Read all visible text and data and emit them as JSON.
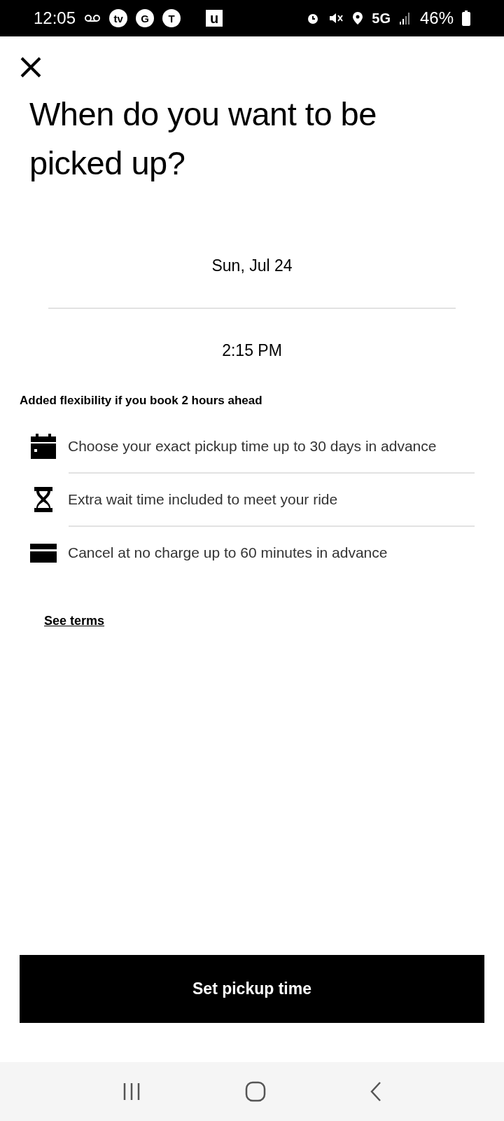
{
  "status_bar": {
    "time": "12:05",
    "badges": [
      "tv",
      "G",
      "T"
    ],
    "square_badge": "u",
    "network": "5G",
    "battery": "46%"
  },
  "title": "When do you want to be picked up?",
  "picker": {
    "date": "Sun, Jul 24",
    "time": "2:15 PM"
  },
  "benefits": {
    "heading": "Added flexibility if you book 2 hours ahead",
    "items": [
      {
        "kind": "calendar",
        "text": "Choose your exact pickup time up to 30 days in advance"
      },
      {
        "kind": "hourglass",
        "text": "Extra wait time included to meet your ride"
      },
      {
        "kind": "card",
        "text": "Cancel at no charge up to 60 minutes in advance"
      }
    ]
  },
  "link": "See terms",
  "button": "Set pickup time"
}
